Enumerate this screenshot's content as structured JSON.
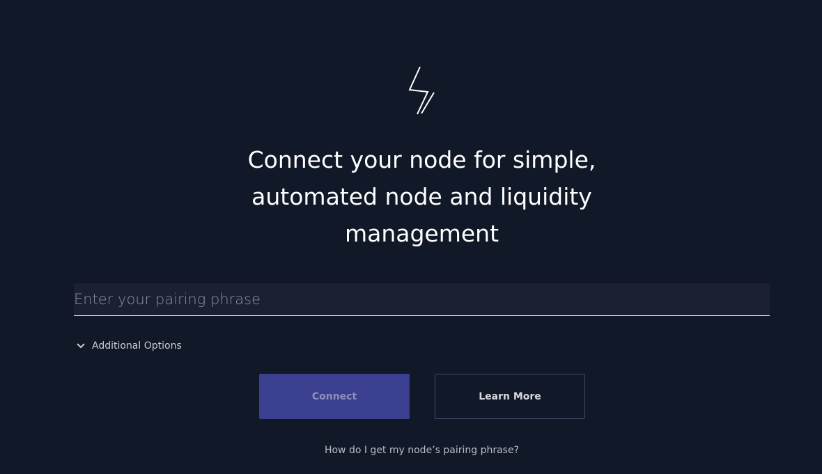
{
  "logo": {
    "icon": "lightning-bolt-icon"
  },
  "headline": {
    "line1": "Connect your node for simple,",
    "line2": "automated node and liquidity",
    "line3": "management"
  },
  "pairing": {
    "placeholder": "Enter your pairing phrase",
    "value": ""
  },
  "options": {
    "label": "Additional Options",
    "icon": "chevron-down-icon"
  },
  "buttons": {
    "connect_label": "Connect",
    "learn_more_label": "Learn More"
  },
  "help": {
    "link_text": "How do I get my node’s pairing phrase?"
  },
  "colors": {
    "background": "#111827",
    "input_background": "#1b2130",
    "connect_button": "#3b3f8f",
    "learn_more_border": "#3f4a6b"
  }
}
